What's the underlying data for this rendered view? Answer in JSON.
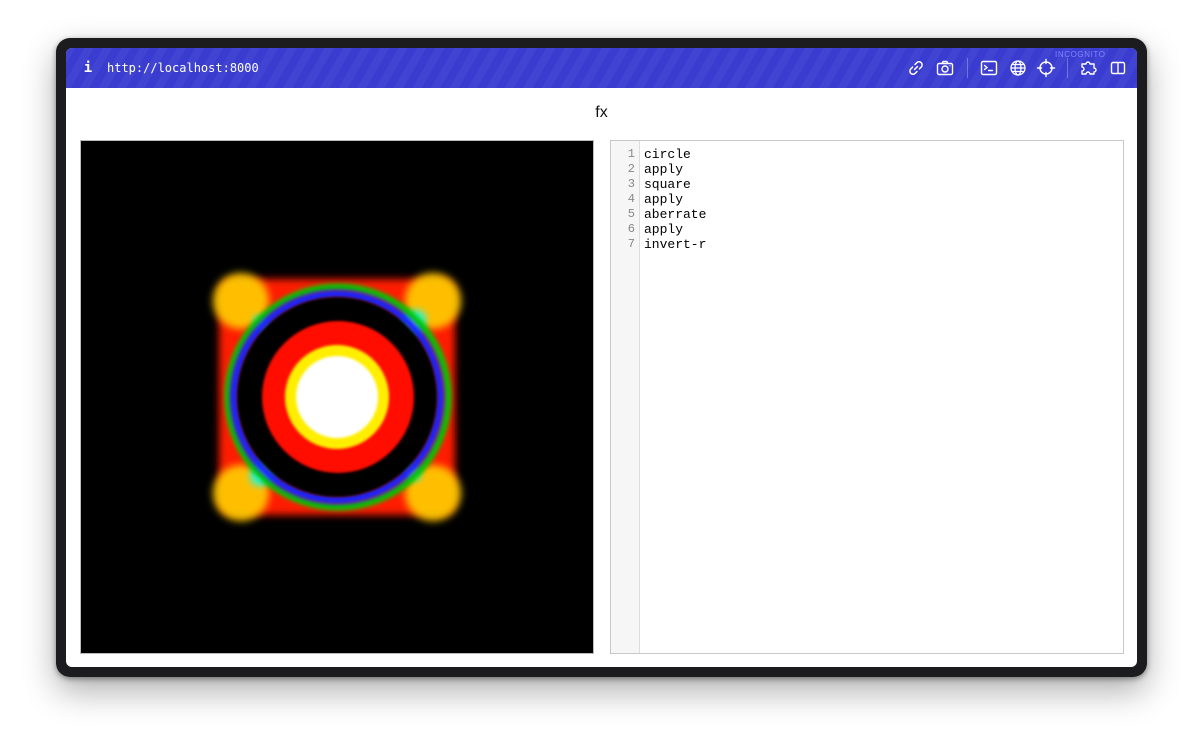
{
  "browser": {
    "info_label": "i",
    "url": "http://localhost:8000",
    "mode_badge": "INCOGNITO",
    "toolbar_icons": [
      "link-icon",
      "camera-icon",
      "terminal-icon",
      "globe-icon",
      "crosshair-icon",
      "puzzle-icon",
      "sidebar-icon"
    ],
    "accent_color": "#3a3cd0"
  },
  "page": {
    "title": "fx"
  },
  "canvas": {
    "background": "#000000",
    "render_colors": [
      "#ffffff",
      "#ffff00",
      "#ff0000",
      "#00ffff",
      "#0000ff",
      "#00ff00"
    ]
  },
  "editor": {
    "line_numbers": [
      "1",
      "2",
      "3",
      "4",
      "5",
      "6",
      "7"
    ],
    "lines": [
      "circle",
      "apply",
      "square",
      "apply",
      "aberrate",
      "apply",
      "invert-r"
    ]
  }
}
